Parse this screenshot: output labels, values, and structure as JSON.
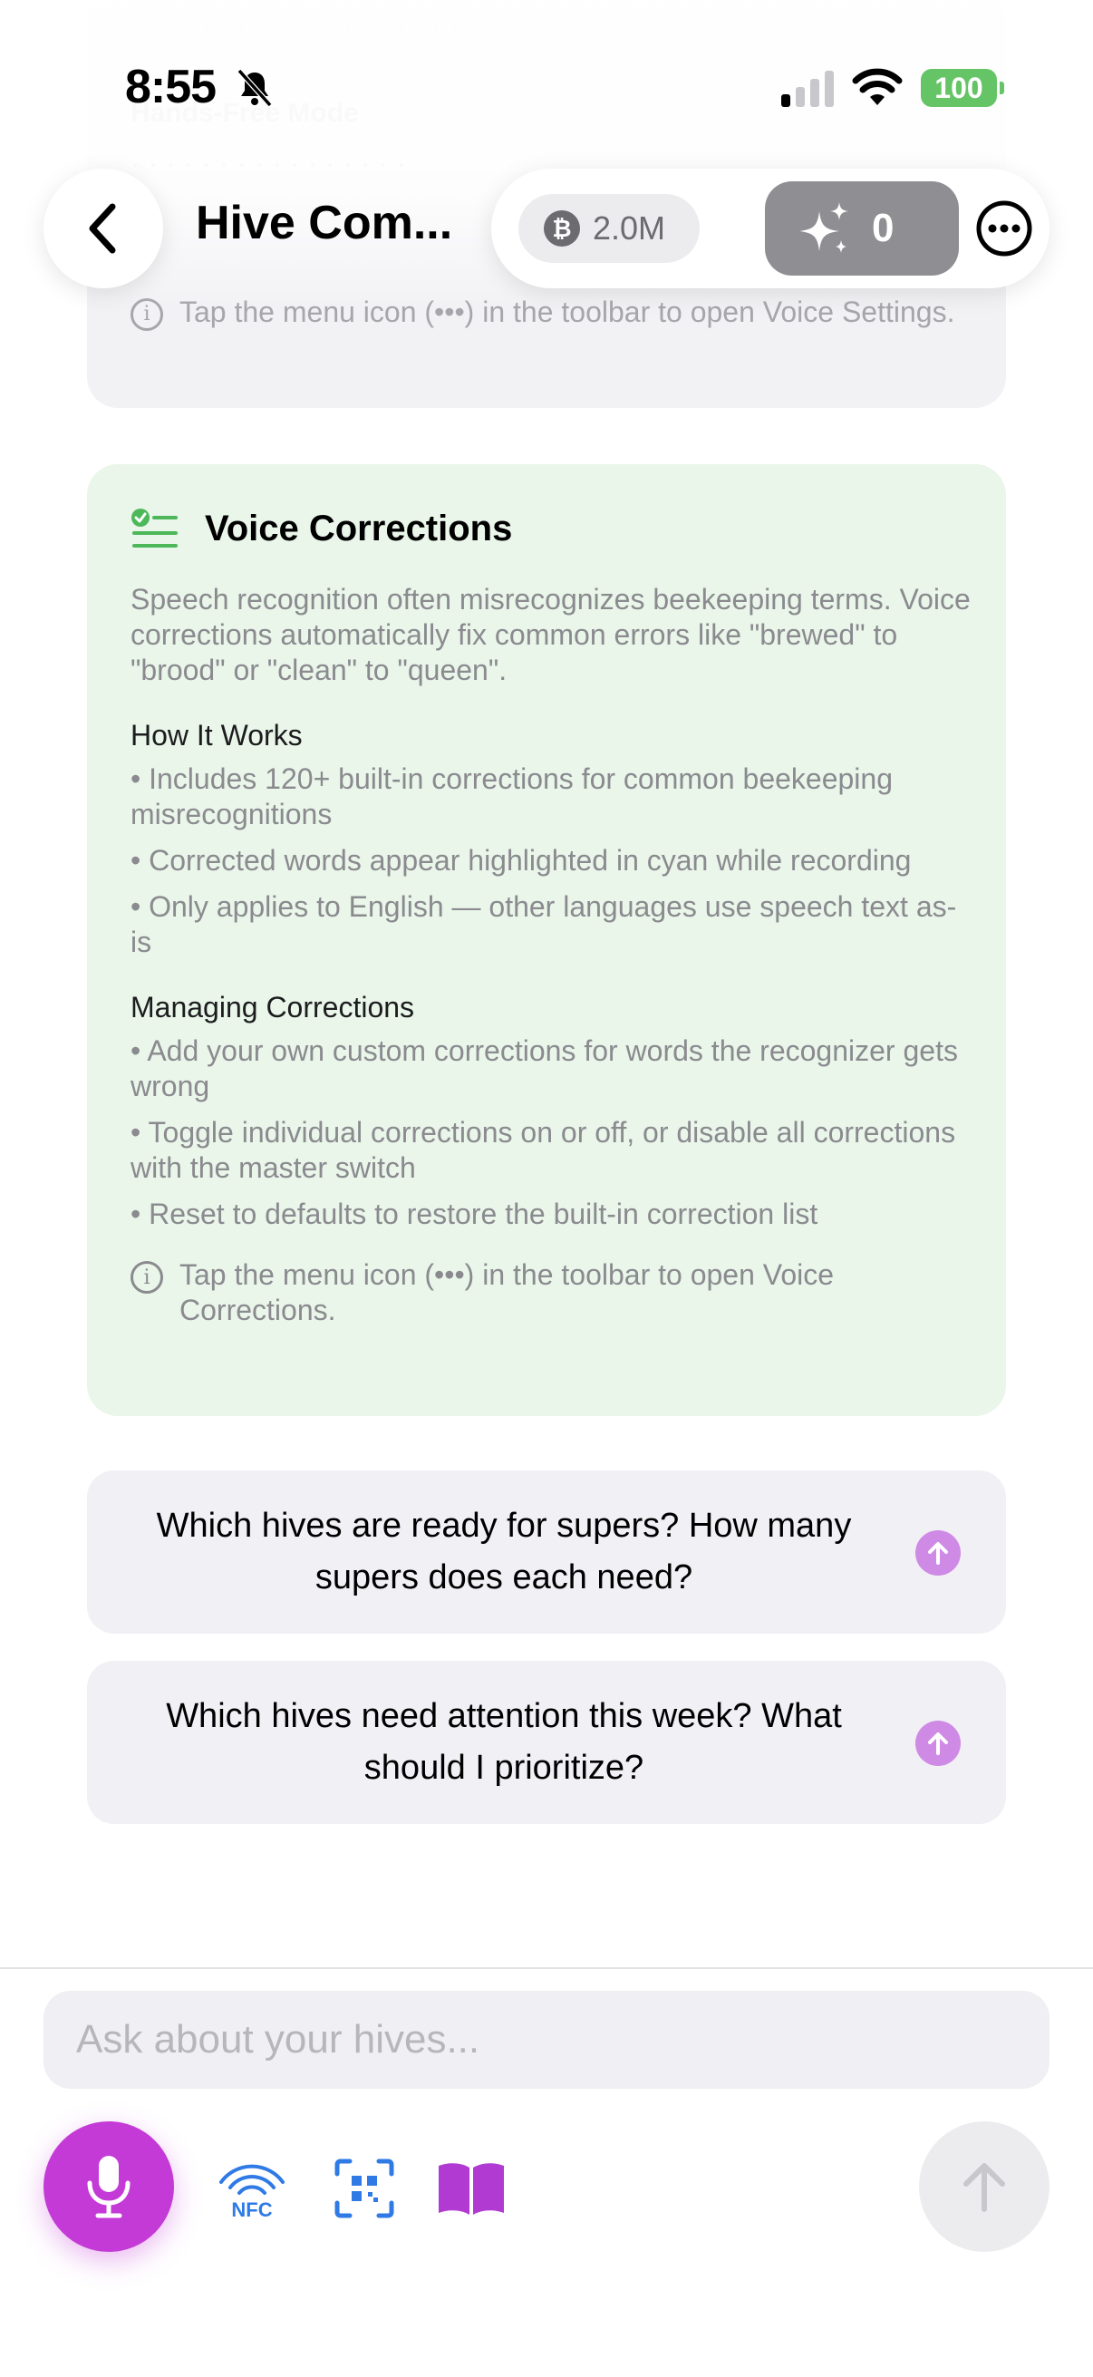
{
  "status_bar": {
    "time": "8:55",
    "battery": "100"
  },
  "faded": {
    "lines": [
      "Tap the menu icon (•••) in the toolbar to open",
      "Voice Settings."
    ],
    "hint": "Tap the menu icon (•••) in the toolbar to open Voice Settings."
  },
  "nav": {
    "title": "Hive Com...",
    "coin_value": "2.0M",
    "coin_symbol": "₿",
    "spark_count": "0"
  },
  "voice_corrections": {
    "title": "Voice Corrections",
    "intro": "Speech recognition often misrecognizes beekeeping terms. Voice corrections automatically fix common errors like \"brewed\" to \"brood\" or \"clean\" to \"queen\".",
    "how_heading": "How It Works",
    "how_bullets": [
      "• Includes 120+ built-in corrections for common beekeeping misrecognitions",
      "• Corrected words appear highlighted in cyan while recording",
      "• Only applies to English — other languages use speech text as-is"
    ],
    "managing_heading": "Managing Corrections",
    "managing_bullets": [
      "• Add your own custom corrections for words the recognizer gets wrong",
      "• Toggle individual corrections on or off, or disable all corrections with the master switch",
      "• Reset to defaults to restore the built-in correction list"
    ],
    "hint": "Tap the menu icon (•••) in the toolbar to open Voice Corrections."
  },
  "suggestions": [
    "Which hives are ready for supers? How many supers does each need?",
    "Which hives need attention this week? What should I prioritize?"
  ],
  "composer": {
    "placeholder": "Ask about your hives...",
    "nfc_label": "NFC"
  },
  "colors": {
    "accent_purple": "#c43ad6",
    "card_green": "#eaf6ea",
    "battery_green": "#65c466",
    "nfc_blue": "#2f7ae5"
  },
  "icons": [
    "chevron-left-icon",
    "bell-slash-icon",
    "signal-icon",
    "wifi-icon",
    "coin-icon",
    "sparkles-icon",
    "ellipsis-circle-icon",
    "checklist-icon",
    "info-icon",
    "arrow-up-icon",
    "microphone-icon",
    "nfc-icon",
    "qr-scan-icon",
    "book-icon"
  ]
}
